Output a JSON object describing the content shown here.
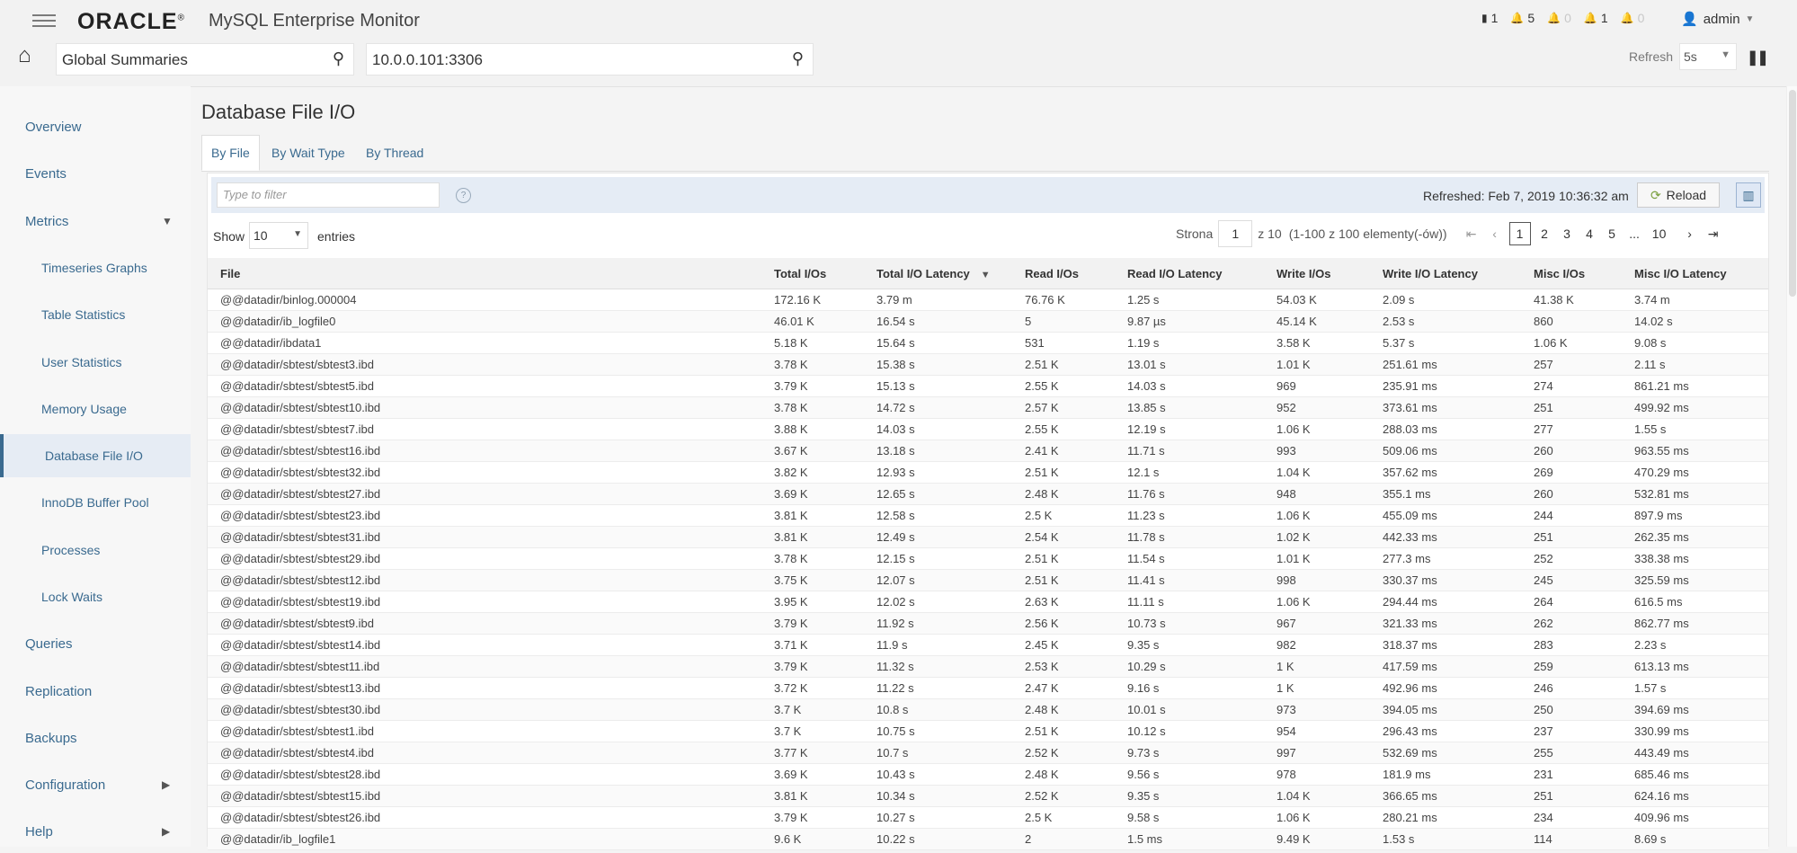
{
  "header": {
    "brand": "ORACLE",
    "brand_mark": "®",
    "product": "MySQL Enterprise Monitor",
    "status": [
      {
        "icon": "server-icon",
        "count": "1",
        "dim": false
      },
      {
        "icon": "bell-warning-icon",
        "count": "5",
        "dim": false
      },
      {
        "icon": "bell-error-icon",
        "count": "0",
        "dim": true
      },
      {
        "icon": "bell-notice-icon",
        "count": "1",
        "dim": false
      },
      {
        "icon": "bell-info-icon",
        "count": "0",
        "dim": true
      }
    ],
    "user": "admin",
    "search_primary": "Global Summaries",
    "search_secondary": "10.0.0.101:3306",
    "refresh_label": "Refresh",
    "refresh_value": "5s"
  },
  "sidebar": {
    "items": [
      {
        "label": "Overview",
        "sub": false,
        "active": false,
        "arrow": ""
      },
      {
        "label": "Events",
        "sub": false,
        "active": false,
        "arrow": ""
      },
      {
        "label": "Metrics",
        "sub": false,
        "active": false,
        "arrow": "▼"
      },
      {
        "label": "Timeseries Graphs",
        "sub": true,
        "active": false,
        "arrow": ""
      },
      {
        "label": "Table Statistics",
        "sub": true,
        "active": false,
        "arrow": ""
      },
      {
        "label": "User Statistics",
        "sub": true,
        "active": false,
        "arrow": ""
      },
      {
        "label": "Memory Usage",
        "sub": true,
        "active": false,
        "arrow": ""
      },
      {
        "label": "Database File I/O",
        "sub": true,
        "active": true,
        "arrow": ""
      },
      {
        "label": "InnoDB Buffer Pool",
        "sub": true,
        "active": false,
        "arrow": ""
      },
      {
        "label": "Processes",
        "sub": true,
        "active": false,
        "arrow": ""
      },
      {
        "label": "Lock Waits",
        "sub": true,
        "active": false,
        "arrow": ""
      },
      {
        "label": "Queries",
        "sub": false,
        "active": false,
        "arrow": ""
      },
      {
        "label": "Replication",
        "sub": false,
        "active": false,
        "arrow": ""
      },
      {
        "label": "Backups",
        "sub": false,
        "active": false,
        "arrow": ""
      },
      {
        "label": "Configuration",
        "sub": false,
        "active": false,
        "arrow": "▶"
      },
      {
        "label": "Help",
        "sub": false,
        "active": false,
        "arrow": "▶"
      }
    ]
  },
  "main": {
    "title": "Database File I/O",
    "tabs": [
      {
        "label": "By File",
        "active": true
      },
      {
        "label": "By Wait Type",
        "active": false
      },
      {
        "label": "By Thread",
        "active": false
      }
    ],
    "filter_placeholder": "Type to filter",
    "refreshed": "Refreshed: Feb 7, 2019 10:36:32 am",
    "reload_label": "Reload",
    "show_label": "Show",
    "show_value": "10",
    "entries_label": "entries",
    "pager": {
      "page_label": "Strona",
      "page_value": "1",
      "of_label": "z 10",
      "range_label": "(1-100 z 100 elementy(-ów))",
      "pages": [
        "1",
        "2",
        "3",
        "4",
        "5",
        "...",
        "10"
      ]
    },
    "columns": [
      "File",
      "Total I/Os",
      "Total I/O Latency",
      "Read I/Os",
      "Read I/O Latency",
      "Write I/Os",
      "Write I/O Latency",
      "Misc I/Os",
      "Misc I/O Latency"
    ],
    "rows": [
      [
        "@@datadir/binlog.000004",
        "172.16 K",
        "3.79 m",
        "76.76 K",
        "1.25 s",
        "54.03 K",
        "2.09 s",
        "41.38 K",
        "3.74 m"
      ],
      [
        "@@datadir/ib_logfile0",
        "46.01 K",
        "16.54 s",
        "5",
        "9.87 µs",
        "45.14 K",
        "2.53 s",
        "860",
        "14.02 s"
      ],
      [
        "@@datadir/ibdata1",
        "5.18 K",
        "15.64 s",
        "531",
        "1.19 s",
        "3.58 K",
        "5.37 s",
        "1.06 K",
        "9.08 s"
      ],
      [
        "@@datadir/sbtest/sbtest3.ibd",
        "3.78 K",
        "15.38 s",
        "2.51 K",
        "13.01 s",
        "1.01 K",
        "251.61 ms",
        "257",
        "2.11 s"
      ],
      [
        "@@datadir/sbtest/sbtest5.ibd",
        "3.79 K",
        "15.13 s",
        "2.55 K",
        "14.03 s",
        "969",
        "235.91 ms",
        "274",
        "861.21 ms"
      ],
      [
        "@@datadir/sbtest/sbtest10.ibd",
        "3.78 K",
        "14.72 s",
        "2.57 K",
        "13.85 s",
        "952",
        "373.61 ms",
        "251",
        "499.92 ms"
      ],
      [
        "@@datadir/sbtest/sbtest7.ibd",
        "3.88 K",
        "14.03 s",
        "2.55 K",
        "12.19 s",
        "1.06 K",
        "288.03 ms",
        "277",
        "1.55 s"
      ],
      [
        "@@datadir/sbtest/sbtest16.ibd",
        "3.67 K",
        "13.18 s",
        "2.41 K",
        "11.71 s",
        "993",
        "509.06 ms",
        "260",
        "963.55 ms"
      ],
      [
        "@@datadir/sbtest/sbtest32.ibd",
        "3.82 K",
        "12.93 s",
        "2.51 K",
        "12.1 s",
        "1.04 K",
        "357.62 ms",
        "269",
        "470.29 ms"
      ],
      [
        "@@datadir/sbtest/sbtest27.ibd",
        "3.69 K",
        "12.65 s",
        "2.48 K",
        "11.76 s",
        "948",
        "355.1 ms",
        "260",
        "532.81 ms"
      ],
      [
        "@@datadir/sbtest/sbtest23.ibd",
        "3.81 K",
        "12.58 s",
        "2.5 K",
        "11.23 s",
        "1.06 K",
        "455.09 ms",
        "244",
        "897.9 ms"
      ],
      [
        "@@datadir/sbtest/sbtest31.ibd",
        "3.81 K",
        "12.49 s",
        "2.54 K",
        "11.78 s",
        "1.02 K",
        "442.33 ms",
        "251",
        "262.35 ms"
      ],
      [
        "@@datadir/sbtest/sbtest29.ibd",
        "3.78 K",
        "12.15 s",
        "2.51 K",
        "11.54 s",
        "1.01 K",
        "277.3 ms",
        "252",
        "338.38 ms"
      ],
      [
        "@@datadir/sbtest/sbtest12.ibd",
        "3.75 K",
        "12.07 s",
        "2.51 K",
        "11.41 s",
        "998",
        "330.37 ms",
        "245",
        "325.59 ms"
      ],
      [
        "@@datadir/sbtest/sbtest19.ibd",
        "3.95 K",
        "12.02 s",
        "2.63 K",
        "11.11 s",
        "1.06 K",
        "294.44 ms",
        "264",
        "616.5 ms"
      ],
      [
        "@@datadir/sbtest/sbtest9.ibd",
        "3.79 K",
        "11.92 s",
        "2.56 K",
        "10.73 s",
        "967",
        "321.33 ms",
        "262",
        "862.77 ms"
      ],
      [
        "@@datadir/sbtest/sbtest14.ibd",
        "3.71 K",
        "11.9 s",
        "2.45 K",
        "9.35 s",
        "982",
        "318.37 ms",
        "283",
        "2.23 s"
      ],
      [
        "@@datadir/sbtest/sbtest11.ibd",
        "3.79 K",
        "11.32 s",
        "2.53 K",
        "10.29 s",
        "1 K",
        "417.59 ms",
        "259",
        "613.13 ms"
      ],
      [
        "@@datadir/sbtest/sbtest13.ibd",
        "3.72 K",
        "11.22 s",
        "2.47 K",
        "9.16 s",
        "1 K",
        "492.96 ms",
        "246",
        "1.57 s"
      ],
      [
        "@@datadir/sbtest/sbtest30.ibd",
        "3.7 K",
        "10.8 s",
        "2.48 K",
        "10.01 s",
        "973",
        "394.05 ms",
        "250",
        "394.69 ms"
      ],
      [
        "@@datadir/sbtest/sbtest1.ibd",
        "3.7 K",
        "10.75 s",
        "2.51 K",
        "10.12 s",
        "954",
        "296.43 ms",
        "237",
        "330.99 ms"
      ],
      [
        "@@datadir/sbtest/sbtest4.ibd",
        "3.77 K",
        "10.7 s",
        "2.52 K",
        "9.73 s",
        "997",
        "532.69 ms",
        "255",
        "443.49 ms"
      ],
      [
        "@@datadir/sbtest/sbtest28.ibd",
        "3.69 K",
        "10.43 s",
        "2.48 K",
        "9.56 s",
        "978",
        "181.9 ms",
        "231",
        "685.46 ms"
      ],
      [
        "@@datadir/sbtest/sbtest15.ibd",
        "3.81 K",
        "10.34 s",
        "2.52 K",
        "9.35 s",
        "1.04 K",
        "366.65 ms",
        "251",
        "624.16 ms"
      ],
      [
        "@@datadir/sbtest/sbtest26.ibd",
        "3.79 K",
        "10.27 s",
        "2.5 K",
        "9.58 s",
        "1.06 K",
        "280.21 ms",
        "234",
        "409.96 ms"
      ],
      [
        "@@datadir/ib_logfile1",
        "9.6 K",
        "10.22 s",
        "2",
        "1.5 ms",
        "9.49 K",
        "1.53 s",
        "114",
        "8.69 s"
      ]
    ]
  }
}
